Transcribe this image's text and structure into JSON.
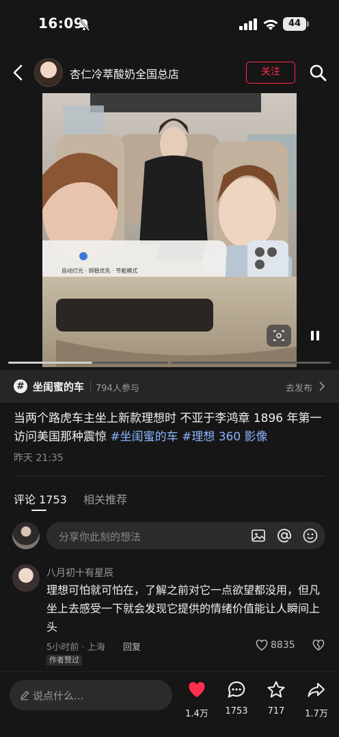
{
  "status_bar": {
    "time": "16:09",
    "battery": "44"
  },
  "header": {
    "shop_name": "杏仁冷萃酸奶全国总店",
    "follow_label": "关注"
  },
  "video": {
    "progress": 0.26
  },
  "topic": {
    "name": "坐闺蜜的车",
    "participants": "794人参与",
    "publish_label": "去发布"
  },
  "post": {
    "caption": "当两个路虎车主坐上新款理想时 不亚于李鸿章 1896 年第一访问美国那种震惊 ",
    "tags": [
      "#坐闺蜜的车",
      "#理想 360 影像"
    ],
    "time": "昨天 21:35"
  },
  "tabs": [
    {
      "label": "评论 1753",
      "active": true
    },
    {
      "label": "相关推荐",
      "active": false
    }
  ],
  "comment_input": {
    "placeholder": "分享你此刻的想法"
  },
  "comment": {
    "user": "八月初十有星辰",
    "text": "理想可怕就可怕在，了解之前对它一点欲望都没用，但凡坐上去感受一下就会发现它提供的情绪价值能让人瞬间上头",
    "meta": "5小时前 · 上海",
    "reply_label": "回复",
    "likes": "8835",
    "badge": "作者赞过"
  },
  "bottom_bar": {
    "placeholder": "说点什么...",
    "likes": "1.4万",
    "comments": "1753",
    "stars": "717",
    "shares": "1.7万"
  },
  "colors": {
    "accent": "#ff2e4d",
    "tag": "#8ab4ff",
    "background": "#161616"
  }
}
